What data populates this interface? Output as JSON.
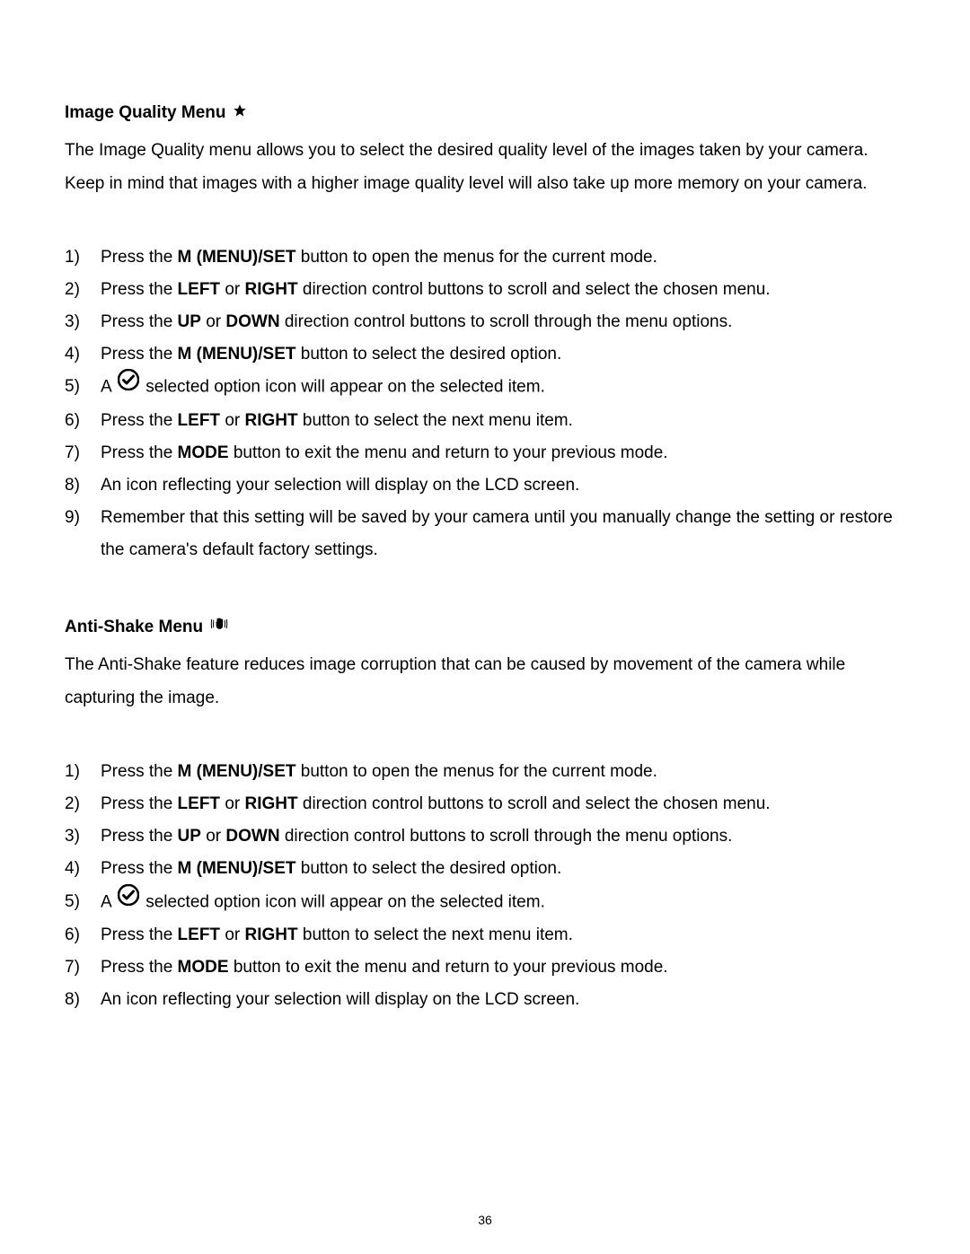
{
  "pageNumber": "36",
  "section1": {
    "heading": "Image Quality Menu",
    "iconName": "star-icon",
    "intro": "The Image Quality menu allows you to select the desired quality level of the images taken by your camera. Keep in mind that images with a higher image quality level will also take up more memory on your camera.",
    "steps": {
      "s1": {
        "num": "1)",
        "pre": "Press the ",
        "b1": "M (MENU)/SET",
        "post": " button to open the menus for the current mode."
      },
      "s2": {
        "num": "2)",
        "pre": "Press the ",
        "b1": "LEFT",
        "mid": " or ",
        "b2": "RIGHT",
        "post": " direction control buttons to scroll and select the chosen menu."
      },
      "s3": {
        "num": "3)",
        "pre": "Press the ",
        "b1": "UP",
        "mid": " or ",
        "b2": "DOWN",
        "post": " direction control buttons to scroll through the menu options."
      },
      "s4": {
        "num": "4)",
        "pre": "Press the ",
        "b1": "M (MENU)/SET",
        "post": " button to select the desired option."
      },
      "s5": {
        "num": "5)",
        "pre": "A ",
        "post": "selected option icon will appear on the selected item."
      },
      "s6": {
        "num": "6)",
        "pre": "Press the ",
        "b1": "LEFT",
        "mid": " or ",
        "b2": "RIGHT",
        "post": " button to select the next menu item."
      },
      "s7": {
        "num": "7)",
        "pre": "Press the ",
        "b1": "MODE",
        "post": " button to exit the menu and return to your previous mode."
      },
      "s8": {
        "num": "8)",
        "text": "An icon reflecting your selection will display on the LCD screen."
      },
      "s9": {
        "num": "9)",
        "text": "Remember that this setting will be saved by your camera until you manually change the setting or restore the camera's default factory settings."
      }
    }
  },
  "section2": {
    "heading": "Anti-Shake Menu",
    "iconName": "anti-shake-icon",
    "intro": "The Anti-Shake feature reduces image corruption that can be caused by movement of the camera while capturing the image.",
    "steps": {
      "s1": {
        "num": "1)",
        "pre": "Press the ",
        "b1": "M (MENU)/SET",
        "post": " button to open the menus for the current mode."
      },
      "s2": {
        "num": "2)",
        "pre": "Press the ",
        "b1": "LEFT",
        "mid": " or ",
        "b2": "RIGHT",
        "post": " direction control buttons to scroll and select the chosen menu."
      },
      "s3": {
        "num": "3)",
        "pre": "Press the ",
        "b1": "UP",
        "mid": " or ",
        "b2": "DOWN",
        "post": " direction control buttons to scroll through the menu options."
      },
      "s4": {
        "num": "4)",
        "pre": "Press the ",
        "b1": "M (MENU)/SET",
        "post": " button to select the desired option."
      },
      "s5": {
        "num": "5)",
        "pre": "A ",
        "post": "selected option icon will appear on the selected item."
      },
      "s6": {
        "num": "6)",
        "pre": "Press the ",
        "b1": "LEFT",
        "mid": " or ",
        "b2": "RIGHT",
        "post": " button to select the next menu item."
      },
      "s7": {
        "num": "7)",
        "pre": "Press the ",
        "b1": "MODE",
        "post": " button to exit the menu and return to your previous mode."
      },
      "s8": {
        "num": "8)",
        "text": "An icon reflecting your selection will display on the LCD screen."
      }
    }
  }
}
